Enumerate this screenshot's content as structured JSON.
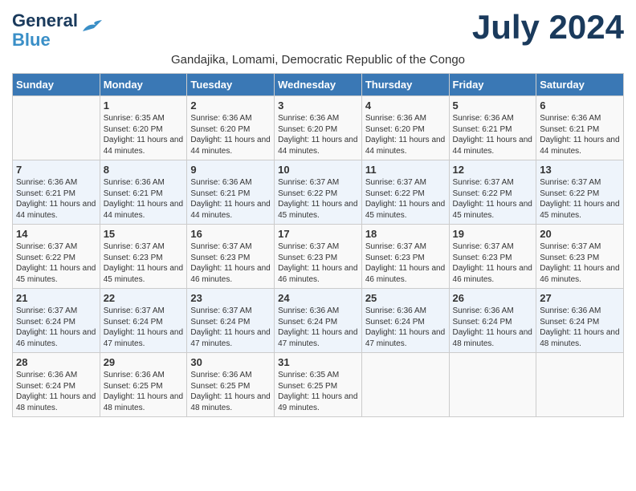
{
  "header": {
    "logo_line1": "General",
    "logo_line2": "Blue",
    "month_year": "July 2024",
    "subtitle": "Gandajika, Lomami, Democratic Republic of the Congo"
  },
  "days_of_week": [
    "Sunday",
    "Monday",
    "Tuesday",
    "Wednesday",
    "Thursday",
    "Friday",
    "Saturday"
  ],
  "weeks": [
    [
      {
        "day": "",
        "sunrise": "",
        "sunset": "",
        "daylight": ""
      },
      {
        "day": "1",
        "sunrise": "Sunrise: 6:35 AM",
        "sunset": "Sunset: 6:20 PM",
        "daylight": "Daylight: 11 hours and 44 minutes."
      },
      {
        "day": "2",
        "sunrise": "Sunrise: 6:36 AM",
        "sunset": "Sunset: 6:20 PM",
        "daylight": "Daylight: 11 hours and 44 minutes."
      },
      {
        "day": "3",
        "sunrise": "Sunrise: 6:36 AM",
        "sunset": "Sunset: 6:20 PM",
        "daylight": "Daylight: 11 hours and 44 minutes."
      },
      {
        "day": "4",
        "sunrise": "Sunrise: 6:36 AM",
        "sunset": "Sunset: 6:20 PM",
        "daylight": "Daylight: 11 hours and 44 minutes."
      },
      {
        "day": "5",
        "sunrise": "Sunrise: 6:36 AM",
        "sunset": "Sunset: 6:21 PM",
        "daylight": "Daylight: 11 hours and 44 minutes."
      },
      {
        "day": "6",
        "sunrise": "Sunrise: 6:36 AM",
        "sunset": "Sunset: 6:21 PM",
        "daylight": "Daylight: 11 hours and 44 minutes."
      }
    ],
    [
      {
        "day": "7",
        "sunrise": "Sunrise: 6:36 AM",
        "sunset": "Sunset: 6:21 PM",
        "daylight": "Daylight: 11 hours and 44 minutes."
      },
      {
        "day": "8",
        "sunrise": "Sunrise: 6:36 AM",
        "sunset": "Sunset: 6:21 PM",
        "daylight": "Daylight: 11 hours and 44 minutes."
      },
      {
        "day": "9",
        "sunrise": "Sunrise: 6:36 AM",
        "sunset": "Sunset: 6:21 PM",
        "daylight": "Daylight: 11 hours and 44 minutes."
      },
      {
        "day": "10",
        "sunrise": "Sunrise: 6:37 AM",
        "sunset": "Sunset: 6:22 PM",
        "daylight": "Daylight: 11 hours and 45 minutes."
      },
      {
        "day": "11",
        "sunrise": "Sunrise: 6:37 AM",
        "sunset": "Sunset: 6:22 PM",
        "daylight": "Daylight: 11 hours and 45 minutes."
      },
      {
        "day": "12",
        "sunrise": "Sunrise: 6:37 AM",
        "sunset": "Sunset: 6:22 PM",
        "daylight": "Daylight: 11 hours and 45 minutes."
      },
      {
        "day": "13",
        "sunrise": "Sunrise: 6:37 AM",
        "sunset": "Sunset: 6:22 PM",
        "daylight": "Daylight: 11 hours and 45 minutes."
      }
    ],
    [
      {
        "day": "14",
        "sunrise": "Sunrise: 6:37 AM",
        "sunset": "Sunset: 6:22 PM",
        "daylight": "Daylight: 11 hours and 45 minutes."
      },
      {
        "day": "15",
        "sunrise": "Sunrise: 6:37 AM",
        "sunset": "Sunset: 6:23 PM",
        "daylight": "Daylight: 11 hours and 45 minutes."
      },
      {
        "day": "16",
        "sunrise": "Sunrise: 6:37 AM",
        "sunset": "Sunset: 6:23 PM",
        "daylight": "Daylight: 11 hours and 46 minutes."
      },
      {
        "day": "17",
        "sunrise": "Sunrise: 6:37 AM",
        "sunset": "Sunset: 6:23 PM",
        "daylight": "Daylight: 11 hours and 46 minutes."
      },
      {
        "day": "18",
        "sunrise": "Sunrise: 6:37 AM",
        "sunset": "Sunset: 6:23 PM",
        "daylight": "Daylight: 11 hours and 46 minutes."
      },
      {
        "day": "19",
        "sunrise": "Sunrise: 6:37 AM",
        "sunset": "Sunset: 6:23 PM",
        "daylight": "Daylight: 11 hours and 46 minutes."
      },
      {
        "day": "20",
        "sunrise": "Sunrise: 6:37 AM",
        "sunset": "Sunset: 6:23 PM",
        "daylight": "Daylight: 11 hours and 46 minutes."
      }
    ],
    [
      {
        "day": "21",
        "sunrise": "Sunrise: 6:37 AM",
        "sunset": "Sunset: 6:24 PM",
        "daylight": "Daylight: 11 hours and 46 minutes."
      },
      {
        "day": "22",
        "sunrise": "Sunrise: 6:37 AM",
        "sunset": "Sunset: 6:24 PM",
        "daylight": "Daylight: 11 hours and 47 minutes."
      },
      {
        "day": "23",
        "sunrise": "Sunrise: 6:37 AM",
        "sunset": "Sunset: 6:24 PM",
        "daylight": "Daylight: 11 hours and 47 minutes."
      },
      {
        "day": "24",
        "sunrise": "Sunrise: 6:36 AM",
        "sunset": "Sunset: 6:24 PM",
        "daylight": "Daylight: 11 hours and 47 minutes."
      },
      {
        "day": "25",
        "sunrise": "Sunrise: 6:36 AM",
        "sunset": "Sunset: 6:24 PM",
        "daylight": "Daylight: 11 hours and 47 minutes."
      },
      {
        "day": "26",
        "sunrise": "Sunrise: 6:36 AM",
        "sunset": "Sunset: 6:24 PM",
        "daylight": "Daylight: 11 hours and 48 minutes."
      },
      {
        "day": "27",
        "sunrise": "Sunrise: 6:36 AM",
        "sunset": "Sunset: 6:24 PM",
        "daylight": "Daylight: 11 hours and 48 minutes."
      }
    ],
    [
      {
        "day": "28",
        "sunrise": "Sunrise: 6:36 AM",
        "sunset": "Sunset: 6:24 PM",
        "daylight": "Daylight: 11 hours and 48 minutes."
      },
      {
        "day": "29",
        "sunrise": "Sunrise: 6:36 AM",
        "sunset": "Sunset: 6:25 PM",
        "daylight": "Daylight: 11 hours and 48 minutes."
      },
      {
        "day": "30",
        "sunrise": "Sunrise: 6:36 AM",
        "sunset": "Sunset: 6:25 PM",
        "daylight": "Daylight: 11 hours and 48 minutes."
      },
      {
        "day": "31",
        "sunrise": "Sunrise: 6:35 AM",
        "sunset": "Sunset: 6:25 PM",
        "daylight": "Daylight: 11 hours and 49 minutes."
      },
      {
        "day": "",
        "sunrise": "",
        "sunset": "",
        "daylight": ""
      },
      {
        "day": "",
        "sunrise": "",
        "sunset": "",
        "daylight": ""
      },
      {
        "day": "",
        "sunrise": "",
        "sunset": "",
        "daylight": ""
      }
    ]
  ]
}
